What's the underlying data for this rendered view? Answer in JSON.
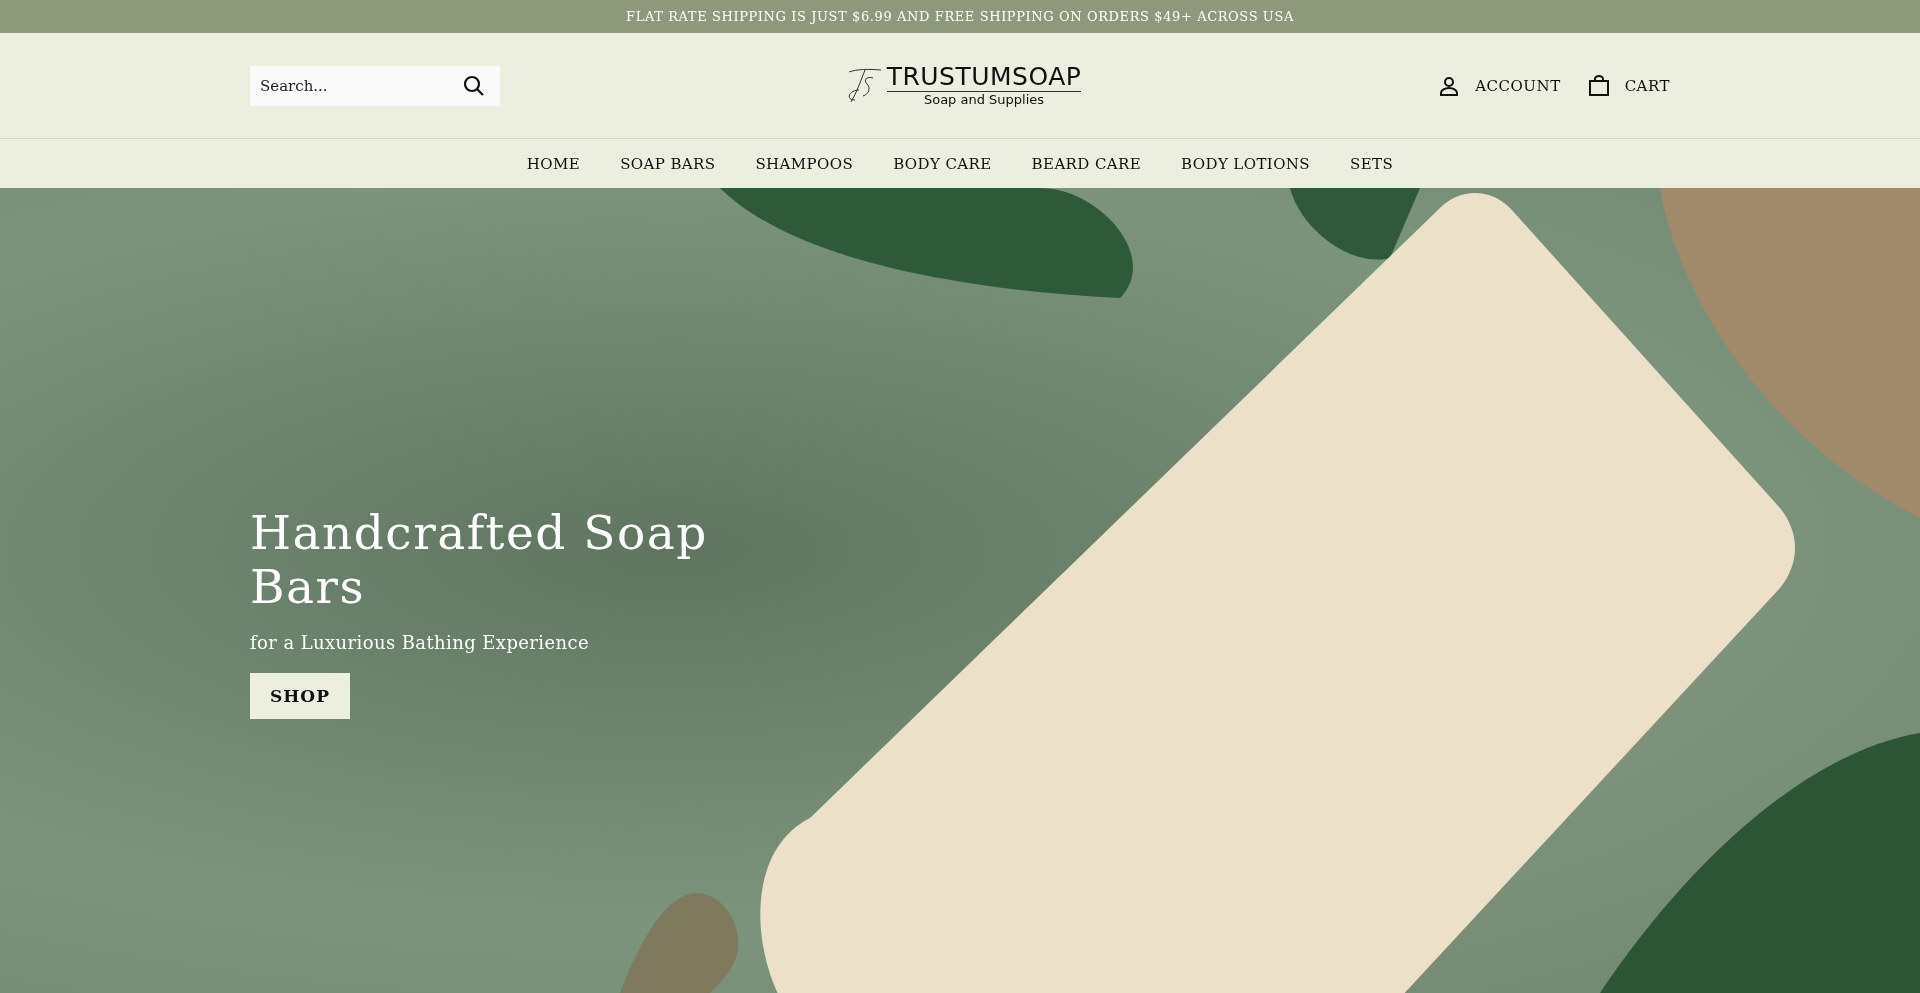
{
  "announcement": "FLAT RATE SHIPPING IS JUST $6.99 AND FREE SHIPPING ON ORDERS $49+ ACROSS USA",
  "header": {
    "search": {
      "placeholder": "Search..."
    },
    "logo": {
      "name": "TRUSTUMSOAP",
      "tagline": "Soap and Supplies"
    },
    "links": [
      {
        "kind": "account",
        "label": "ACCOUNT"
      },
      {
        "kind": "cart",
        "label": "CART"
      }
    ]
  },
  "nav": [
    "HOME",
    "SOAP BARS",
    "SHAMPOOS",
    "BODY CARE",
    "BEARD CARE",
    "BODY LOTIONS",
    "SETS"
  ],
  "hero": {
    "title": "Handcrafted Soap Bars",
    "subtitle": "for a Luxurious Bathing Experience",
    "button": "SHOP"
  }
}
